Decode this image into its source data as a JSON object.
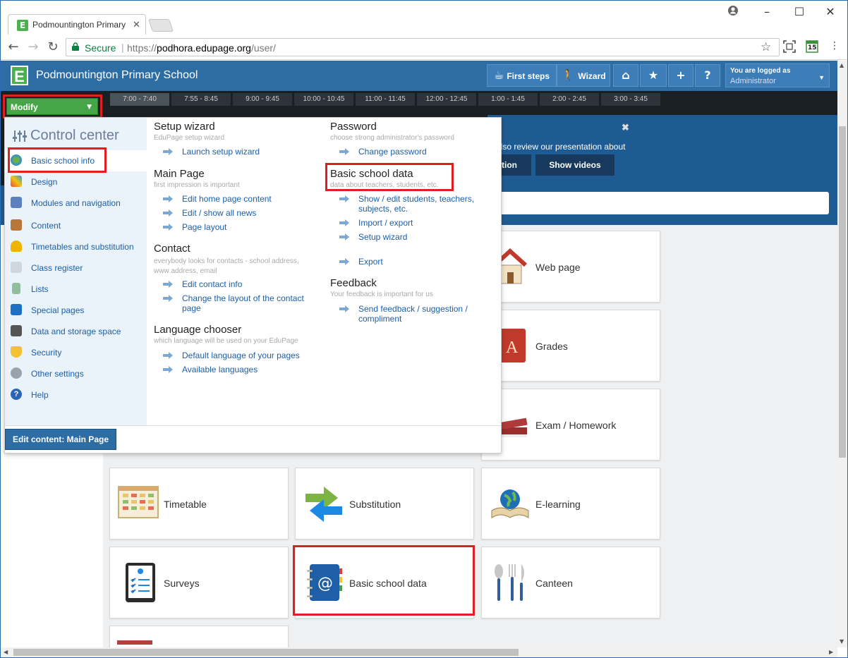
{
  "browser": {
    "tab_title": "Podmountington Primary School",
    "secure_label": "Secure",
    "url_scheme": "https://",
    "url_host": "podhora.edupage.org",
    "url_path": "/user/",
    "calendar_day": "15"
  },
  "header": {
    "logo_letter": "E",
    "school_name": "Podmountington Primary School",
    "first_steps": "First steps",
    "wizard": "Wizard",
    "logged_label": "You are logged as",
    "logged_user": "Administrator"
  },
  "timeline": [
    "7:00 - 7:40",
    "7:55 - 8:45",
    "9:00 - 9:45",
    "10:00 - 10:45",
    "11:00 - 11:45",
    "12:00 - 12:45",
    "1:00 - 1:45",
    "2:00 - 2:45",
    "3:00 - 3:45"
  ],
  "banner": {
    "text": "also review our presentation about",
    "btn1": "tion",
    "btn2": "Show videos",
    "close": "✖"
  },
  "modify_label": "Modify",
  "control_center": {
    "title": "Control center",
    "items": [
      "Basic school info",
      "Design",
      "Modules and navigation",
      "Content",
      "Timetables and substitution",
      "Class register",
      "Lists",
      "Special pages",
      "Data and storage space",
      "Security",
      "Other settings",
      "Help"
    ],
    "edit_button": "Edit content: Main Page"
  },
  "menu": {
    "col1": [
      {
        "title": "Setup wizard",
        "sub": "EduPage setup wizard",
        "links": [
          "Launch setup wizard"
        ]
      },
      {
        "title": "Main Page",
        "sub": "first impression is important",
        "links": [
          "Edit home page content",
          "Edit / show all news",
          "Page layout"
        ]
      },
      {
        "title": "Contact",
        "sub": "everybody looks for contacts - school address, www address, email",
        "links": [
          "Edit contact info",
          "Change the layout of the contact page"
        ]
      },
      {
        "title": "Language chooser",
        "sub": "which language will be used on your EduPage",
        "links": [
          "Default language of your pages",
          "Available languages"
        ]
      }
    ],
    "col2": [
      {
        "title": "Password",
        "sub": "choose strong administrator's password",
        "links": [
          "Change password"
        ]
      },
      {
        "title": "Basic school data",
        "sub": "data about teachers, students, etc.",
        "links": [
          "Show / edit students, teachers, subjects, etc.",
          "Import / export",
          "Setup wizard",
          "Export"
        ]
      },
      {
        "title": "Feedback",
        "sub": "Your feedback is important for us",
        "links": [
          "Send feedback / suggestion / compliment"
        ]
      }
    ]
  },
  "tiles": [
    "Web page",
    "Grades",
    "Exam / Homework",
    "Timetable",
    "Substitution",
    "E-learning",
    "Surveys",
    "Basic school data",
    "Canteen"
  ],
  "colors": {
    "header": "#2e6da4",
    "modify": "#46a546",
    "highlight": "#e02020",
    "link": "#1c5fa8"
  }
}
